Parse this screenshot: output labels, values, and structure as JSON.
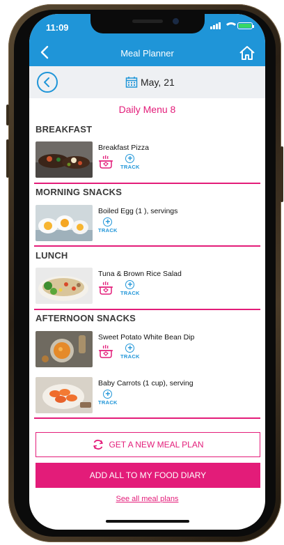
{
  "status": {
    "time": "11:09"
  },
  "nav": {
    "title": "Meal Planner"
  },
  "date": {
    "label": "May, 21"
  },
  "menu": {
    "title": "Daily Menu 8"
  },
  "sections": [
    {
      "title": "BREAKFAST",
      "items": [
        {
          "name": "Breakfast Pizza",
          "track": "TRACK"
        }
      ]
    },
    {
      "title": "MORNING SNACKS",
      "items": [
        {
          "name": "Boiled Egg (1 ), servings",
          "track": "TRACK"
        }
      ]
    },
    {
      "title": "LUNCH",
      "items": [
        {
          "name": "Tuna & Brown Rice Salad",
          "track": "TRACK"
        }
      ]
    },
    {
      "title": "AFTERNOON SNACKS",
      "items": [
        {
          "name": "Sweet Potato White Bean Dip",
          "track": "TRACK"
        },
        {
          "name": "Baby Carrots (1 cup), serving",
          "track": "TRACK"
        }
      ]
    }
  ],
  "actions": {
    "new_plan": "GET A NEW MEAL PLAN",
    "add_all": "ADD ALL TO MY FOOD DIARY",
    "see_all": "See all meal plans"
  },
  "colors": {
    "brand_blue": "#1f95d8",
    "accent_pink": "#e31c79",
    "date_bg": "#eef0f3"
  },
  "icons": [
    "back-arrow-icon",
    "home-icon",
    "calendar-icon",
    "cook-pot-icon",
    "track-plus-icon",
    "refresh-icon"
  ]
}
